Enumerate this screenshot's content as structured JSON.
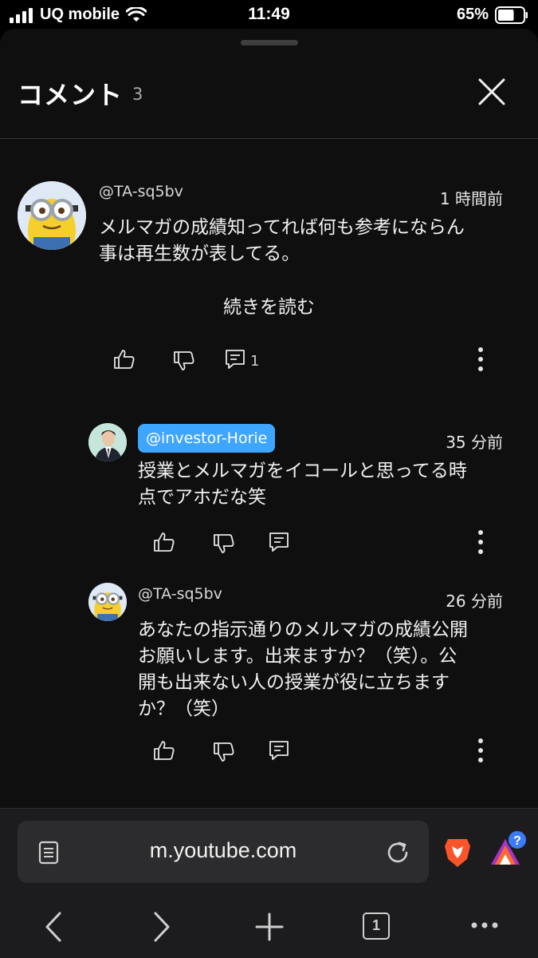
{
  "status_bar": {
    "carrier": "UQ mobile",
    "time": "11:49",
    "battery_percent": "65%",
    "battery_level": 0.65
  },
  "comments_panel": {
    "title": "コメント",
    "count": "3"
  },
  "thread": {
    "top_comment": {
      "author": "@TA-sq5bv",
      "time": "1 時間前",
      "lines": [
        "メルマガの成績知ってれば何も参考にならん",
        "事は再生数が表してる。"
      ],
      "read_more": "続きを読む",
      "reply_count": "1"
    },
    "replies": [
      {
        "author": "@investor-Horie",
        "time": "35 分前",
        "lines": [
          "授業とメルマガをイコールと思ってる時",
          "点でアホだな笑"
        ]
      },
      {
        "author": "@TA-sq5bv",
        "time": "26 分前",
        "lines": [
          "あなたの指示通りのメルマガの成績公開",
          "お願いします。出来ますか？（笑）。公",
          "開も出来ない人の授業が役に立ちます",
          "か？（笑）"
        ]
      }
    ]
  },
  "browser": {
    "url": "m.youtube.com",
    "tab_count": "1"
  },
  "colors": {
    "sheet_background": "#0f0f0f",
    "mention_chip": "#3ea6ff",
    "toolbar_background": "#1c1c1e"
  }
}
